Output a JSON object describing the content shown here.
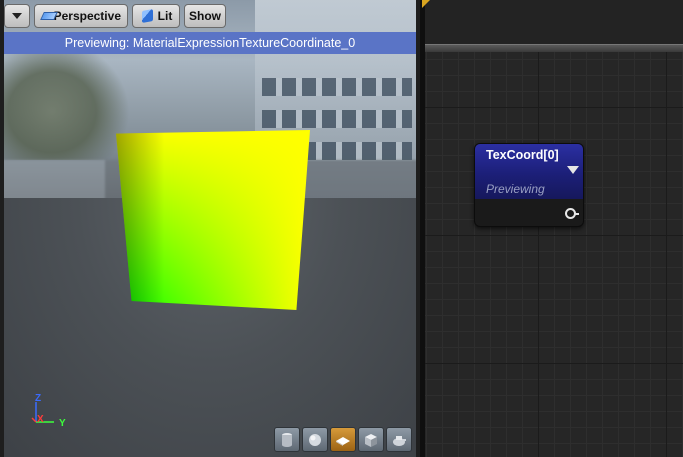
{
  "viewport": {
    "toolbar": {
      "dropdown_icon": "chevron-down-icon",
      "perspective_label": "Perspective",
      "lit_label": "Lit",
      "show_label": "Show"
    },
    "preview_banner": "Previewing: MaterialExpressionTextureCoordinate_0",
    "axis_gizmo": {
      "z": "Z",
      "x": "X",
      "y": "Y",
      "colors": {
        "x": "#ff3b3b",
        "y": "#3cff3c",
        "z": "#3a6bff"
      }
    },
    "preview_shapes": [
      {
        "name": "cylinder",
        "icon": "cylinder-icon",
        "active": false
      },
      {
        "name": "sphere",
        "icon": "sphere-icon",
        "active": false
      },
      {
        "name": "plane",
        "icon": "plane-icon",
        "active": true
      },
      {
        "name": "cube",
        "icon": "cube-icon",
        "active": false
      },
      {
        "name": "custom-mesh",
        "icon": "teapot-icon",
        "active": false
      }
    ],
    "preview_material_gradient": {
      "left": "#00ff00",
      "right": "#ffff00",
      "top": "#ff0000"
    }
  },
  "graph": {
    "node": {
      "title": "TexCoord[0]",
      "status": "Previewing",
      "header_color": "#2b2fa2"
    }
  }
}
